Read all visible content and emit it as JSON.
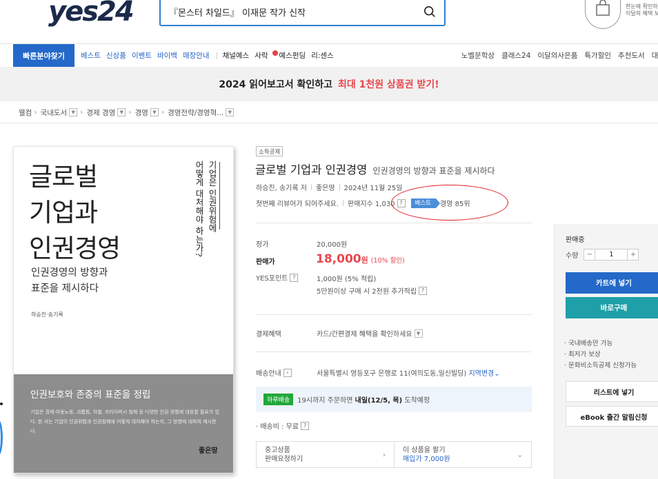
{
  "header": {
    "logo": "yes24",
    "search_value": "『몬스터 차일드』 이재문 작가 신작",
    "promo_side": [
      "한눈에 확인하",
      "이달의 혜택 보"
    ]
  },
  "nav": {
    "quick": "빠른분야찾기",
    "left_blue": [
      "베스트",
      "신상품",
      "이벤트",
      "바이백",
      "매장안내"
    ],
    "left_dark": [
      "채널예스",
      "사락",
      "예스펀딩",
      "리:센스"
    ],
    "right": [
      "노벨문학상",
      "클래스24",
      "이달의사은품",
      "특가할인",
      "추천도서",
      "대량"
    ]
  },
  "banner": {
    "text": "2024 읽어보고서 확인하고",
    "highlight": "최대 1천원 상품권 받기!"
  },
  "breadcrumb": [
    "웰컴",
    "국내도서",
    "경제 경영",
    "경영",
    "경영전략/경영혁..."
  ],
  "cover": {
    "title_lines": [
      "글로벌",
      "기업과",
      "인권경영"
    ],
    "vertical_1": "기업은 인권위험에",
    "vertical_2": "어떻게 대처해야 하는가?",
    "subtitle_lines": [
      "인권경영의 방향과",
      "표준을 제시하다"
    ],
    "authors": "하승진·송기록",
    "bottom_title": "인권보호와 존중의 표준을 정립",
    "bottom_desc": "기업은 경제·아동노동, 괴롭힘, 차별, 프라이버시 침해 등 다양한 인권 위험에 대응할 필요가 있다. 본 서는 기업이 인권위험과 인권침해에 어떻게 대처해야 하는지, 그 방향에 대하여 제시한다.",
    "publisher": "좋은땅"
  },
  "product": {
    "tag": "소득공제",
    "title": "글로벌 기업과 인권경영",
    "subtitle": "인권경영의 방향과 표준을 제시하다",
    "author": "하승진, 송기록 저",
    "publisher": "좋은땅",
    "date": "2024년 11월 25일",
    "review": "첫번째 리뷰어가 되어주세요.",
    "sales_index": "판매지수 1,030",
    "best_label": "베스트",
    "rank": "경영 85위"
  },
  "price": {
    "list_label": "정가",
    "list_value": "20,000원",
    "sale_label": "판매가",
    "sale_value": "18,000",
    "sale_unit": "원",
    "discount": "(10% 할인)",
    "point_label": "YES포인트",
    "point_value": "1,000원 (5% 적립)",
    "point_extra": "5만원이상 구매 시 2천원 추가적립",
    "pay_label": "결제혜택",
    "pay_value": "카드/간편결제 혜택을 확인하세요",
    "ship_label": "배송안내",
    "ship_addr": "서울특별시 영등포구 은행로 11(여의도동,일신빌딩)",
    "ship_change": "지역변경",
    "ship_badge": "하루배송",
    "ship_text1": "19시까지 주문하면",
    "ship_bold": "내일(12/5, 목)",
    "ship_text2": "도착예정",
    "fee": "· 배송비 : 무료",
    "used_title": "중고상품",
    "used_sub": "판매요청하기",
    "sell_title": "이 상품을 팔기",
    "sell_sub": "매입가 7,000원"
  },
  "side": {
    "status": "판매중",
    "qty_label": "수량",
    "qty_value": "1",
    "cart": "카트에 넣기",
    "buy": "바로구매",
    "notes": [
      "· 국내배송만 가능",
      "· 최저가 보상",
      "· 문화비소득공제 신청가능"
    ],
    "list": "리스트에 넣기",
    "ebook": "eBook 출간 알림신청"
  }
}
